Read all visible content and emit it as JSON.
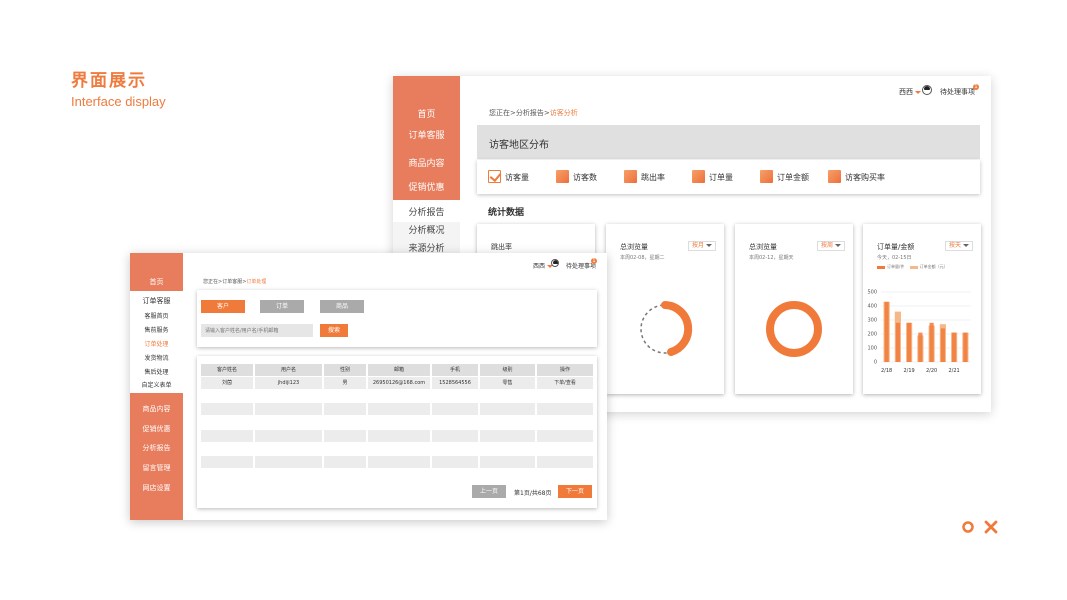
{
  "heading": {
    "zh": "界面展示",
    "en": "Interface display"
  },
  "back": {
    "sidebar": [
      "首页",
      "订单客服",
      "商品内容",
      "促销优惠",
      "分析报告",
      "分析概况",
      "来源分析"
    ],
    "user": "西西",
    "todo": "待处理事项",
    "todo_count": "1",
    "breadcrumb": {
      "prefix": "您正在>分析报告>",
      "current": "访客分析"
    },
    "region_title": "访客地区分布",
    "metrics": [
      {
        "label": "访客量",
        "checked": true
      },
      {
        "label": "访客数",
        "checked": false
      },
      {
        "label": "跳出率",
        "checked": false
      },
      {
        "label": "订单量",
        "checked": false
      },
      {
        "label": "订单金额",
        "checked": false
      },
      {
        "label": "访客购买率",
        "checked": false
      }
    ],
    "stat_title": "统计数据",
    "cards": [
      {
        "title": "跳出率"
      },
      {
        "title": "总浏览量",
        "subtitle": "本周02-08，星期二",
        "select": "按月"
      },
      {
        "title": "总浏览量",
        "subtitle": "本周02-12，星期天",
        "select": "按周"
      },
      {
        "title": "订单量/金额",
        "subtitle": "今天，02-15日",
        "select": "按天"
      }
    ],
    "chart_data": {
      "type": "bar",
      "title": "订单量/金额",
      "categories": [
        "2/18",
        "",
        "2/19",
        "",
        "2/20",
        "",
        "2/21",
        ""
      ],
      "series": [
        {
          "name": "订单量/件",
          "values": [
            430,
            280,
            280,
            210,
            280,
            240,
            210,
            210
          ]
        },
        {
          "name": "订单金额（元）",
          "values": [
            430,
            360,
            280,
            190,
            260,
            270,
            210,
            210
          ]
        }
      ],
      "yticks": [
        0,
        100,
        200,
        300,
        400,
        500
      ],
      "xticks": [
        "2/18",
        "2/19",
        "2/20",
        "2/21"
      ],
      "ylim": [
        0,
        500
      ],
      "colors": {
        "orders": "#f07a3a",
        "amount": "#f6b889"
      }
    }
  },
  "front": {
    "sidebar": {
      "home": "首页",
      "order_service": "订单客服",
      "sub": [
        "客服首页",
        "售前服务",
        "订单处理",
        "发货物流",
        "售后处理",
        "自定义表单"
      ],
      "rest": [
        "商品内容",
        "促销优惠",
        "分析报告",
        "留言管理",
        "网店设置"
      ]
    },
    "user": "西西",
    "todo": "待处理事项",
    "todo_count": "1",
    "breadcrumb": {
      "prefix": "您正在>订单客服>",
      "current": "订单处理"
    },
    "tabs": [
      "客户",
      "订单",
      "商品"
    ],
    "search_placeholder": "请输入客户姓名/用户名/手机邮箱",
    "search_button": "搜索",
    "table": {
      "headers": [
        "客户姓名",
        "用户名",
        "性别",
        "邮箱",
        "手机",
        "级别",
        "操作"
      ],
      "rows": [
        [
          "刘茵",
          "jhdiji123",
          "男",
          "26950126@168.com",
          "1528564556",
          "零售",
          "下单/查看"
        ]
      ]
    },
    "pagination": {
      "prev": "上一页",
      "info": "第1页/共68页",
      "next": "下一页"
    }
  },
  "accent": "#ef7b3e",
  "sidebar_color": "#e87d5e"
}
